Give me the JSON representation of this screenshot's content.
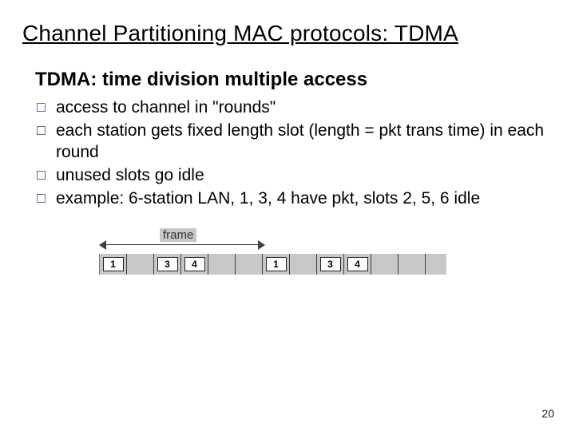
{
  "title": "Channel Partitioning MAC protocols: TDMA",
  "subtitle": "TDMA: time division multiple access",
  "bullets": [
    "access to channel in \"rounds\"",
    "each station gets fixed length slot (length = pkt trans time) in each round",
    "unused slots go idle",
    "example: 6-station LAN, 1, 3, 4 have pkt, slots 2, 5, 6 idle"
  ],
  "diagram": {
    "frame_label": "frame",
    "slots": [
      {
        "label": "1",
        "active": true
      },
      {
        "label": "",
        "active": false
      },
      {
        "label": "3",
        "active": true
      },
      {
        "label": "4",
        "active": true
      },
      {
        "label": "",
        "active": false
      },
      {
        "label": "",
        "active": false
      },
      {
        "label": "1",
        "active": true
      },
      {
        "label": "",
        "active": false
      },
      {
        "label": "3",
        "active": true
      },
      {
        "label": "4",
        "active": true
      },
      {
        "label": "",
        "active": false
      },
      {
        "label": "",
        "active": false
      }
    ]
  },
  "page_number": "20"
}
